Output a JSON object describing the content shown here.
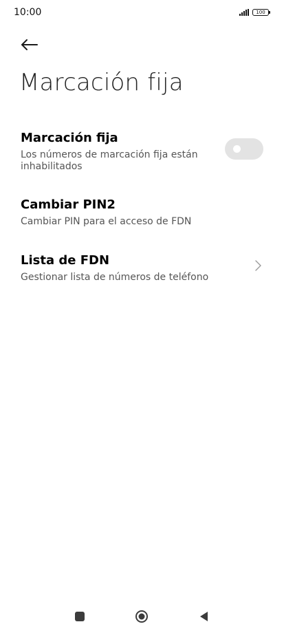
{
  "status_bar": {
    "time": "10:00",
    "battery": "100"
  },
  "header": {
    "title": "Marcación fija"
  },
  "settings": {
    "items": [
      {
        "title": "Marcación fija",
        "description": "Los números de marcación fija están inhabilitados",
        "toggle_on": false
      },
      {
        "title": "Cambiar PIN2",
        "description": "Cambiar PIN para el acceso de FDN"
      },
      {
        "title": "Lista de FDN",
        "description": "Gestionar lista de números de teléfono"
      }
    ]
  },
  "colors": {
    "toggle_off_track": "#e3e3e3",
    "text_primary": "#000000",
    "text_secondary": "#555555"
  },
  "icons": {
    "back": "arrow-left-icon",
    "chevron": "chevron-right-icon",
    "nav_recent": "square-icon",
    "nav_home": "circle-icon",
    "nav_back": "triangle-back-icon"
  }
}
